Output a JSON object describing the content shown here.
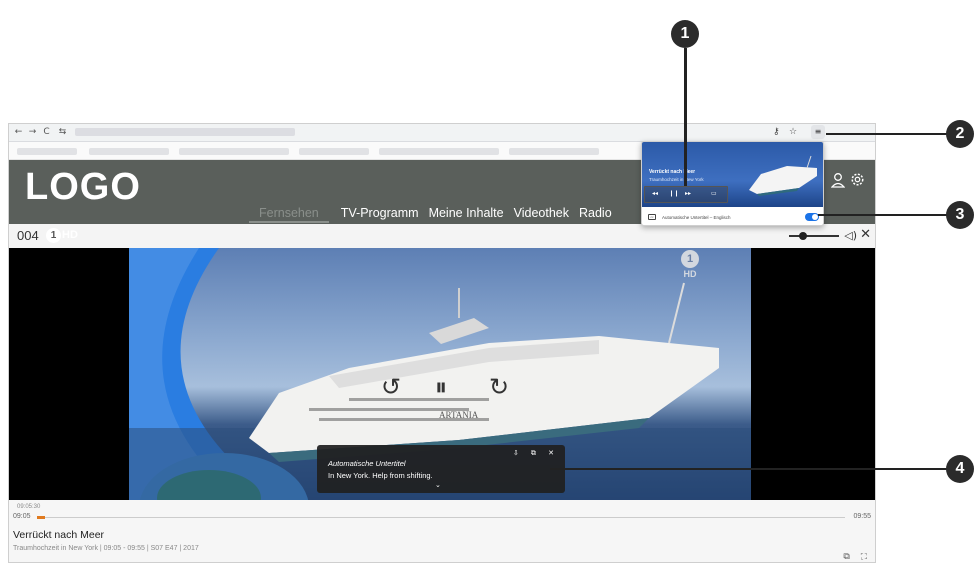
{
  "browser": {
    "back_glyph": "←",
    "forward_glyph": "→",
    "reload_glyph": "C",
    "site_info_glyph": "⇆",
    "key_icon_glyph": "⚷",
    "star_glyph": "☆",
    "ext_glyph": "≡"
  },
  "header": {
    "logo": "LOGO",
    "nav": [
      "Fernsehen",
      "TV-Programm",
      "Meine Inhalte",
      "Videothek",
      "Radio"
    ]
  },
  "player": {
    "channel_number": "004",
    "channel_badge_number": "1",
    "channel_badge_text": "HD",
    "close_glyph": "✕",
    "volume_glyph": "◁)",
    "volume_level": 0.3,
    "controls": {
      "rewind_glyph": "↺",
      "pause_glyph": "⏸",
      "forward_glyph": "↻"
    },
    "watermark_number": "1",
    "watermark_text": "HD",
    "ship_name": "ARTANIA"
  },
  "subtitle_overlay": {
    "title": "Automatische Untertitel",
    "text": "In New York. Help from shifting.",
    "icons": "⇩ ⧉ ✕",
    "chevron": "⌄"
  },
  "progress": {
    "hover_time": "09:05:30",
    "start": "09:05",
    "end": "09:55",
    "played_fraction": 0.01,
    "title": "Verrückt nach Meer",
    "meta": "Traumhochzeit in New York | 09:05 - 09:55 | S07 E47 | 2017",
    "bottom_icons": "⧉ ⛶"
  },
  "popup": {
    "title": "Verrückt nach Meer",
    "subtitle": "Traumhochzeit in New York",
    "btn_rewind": "◂◂",
    "btn_pause": "❙❙",
    "btn_forward": "▸▸",
    "btn_pip": "▭",
    "cc_glyph": "cc",
    "cc_label": "Automatische Untertitel – Englisch",
    "toggle_on": true
  },
  "callouts": [
    "1",
    "2",
    "3",
    "4"
  ]
}
